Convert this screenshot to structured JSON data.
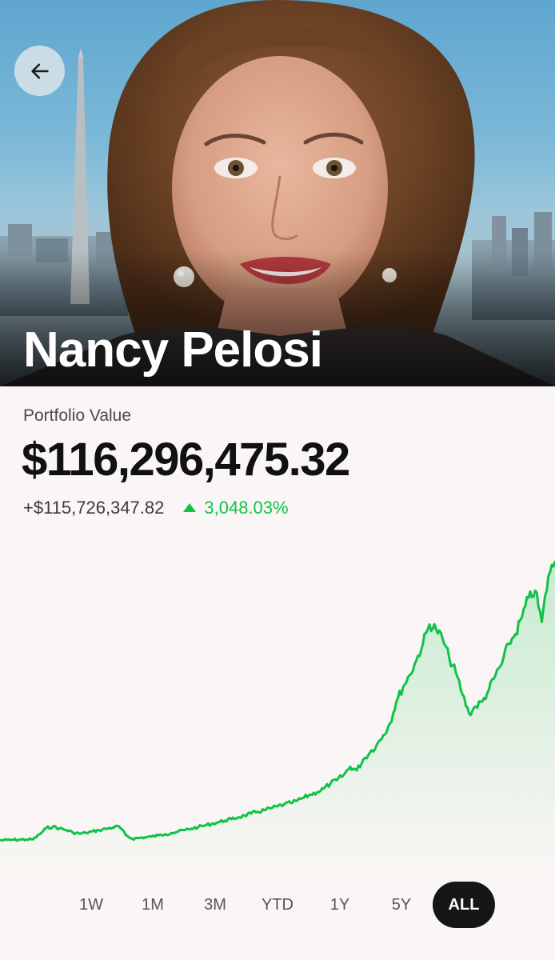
{
  "header": {
    "back_icon": "arrow-left-icon",
    "name": "Nancy Pelosi"
  },
  "portfolio": {
    "label": "Portfolio Value",
    "value": "$116,296,475.32",
    "change_amount": "+$115,726,347.82",
    "change_percent": "3,048.03%",
    "trend_icon": "triangle-up-icon"
  },
  "colors": {
    "positive": "#10c24a",
    "active_tab_bg": "#161616",
    "background": "#faf6f5"
  },
  "range_tabs": [
    {
      "label": "1W",
      "active": false
    },
    {
      "label": "1M",
      "active": false
    },
    {
      "label": "3M",
      "active": false
    },
    {
      "label": "YTD",
      "active": false
    },
    {
      "label": "1Y",
      "active": false
    },
    {
      "label": "5Y",
      "active": false
    },
    {
      "label": "ALL",
      "active": true
    }
  ],
  "chart_data": {
    "type": "area",
    "title": "",
    "xlabel": "",
    "ylabel": "",
    "ylim": [
      0,
      120000000
    ],
    "grid": false,
    "color": "#10c24a",
    "series": [
      {
        "values": [
          570127,
          650000,
          720000,
          800000,
          860000,
          900000,
          3000000,
          5600000,
          6200000,
          5500000,
          4800000,
          3800000,
          3300000,
          3600000,
          4200000,
          4700000,
          5300000,
          5800000,
          6300000,
          2800000,
          1200000,
          1500000,
          1800000,
          2100000,
          2600000,
          3100000,
          3600000,
          4200000,
          4800000,
          5400000,
          6000000,
          6700000,
          7300000,
          8000000,
          8700000,
          9300000,
          10000000,
          10800000,
          11600000,
          12400000,
          13000000,
          13800000,
          14600000,
          15400000,
          16000000,
          17000000,
          18200000,
          19500000,
          20500000,
          22000000,
          24000000,
          25500000,
          27500000,
          31000000,
          29500000,
          34000000,
          37000000,
          40000000,
          44000000,
          49000000,
          58000000,
          64000000,
          69000000,
          75000000,
          82000000,
          90000000,
          88000000,
          84000000,
          76000000,
          70000000,
          61000000,
          53000000,
          56000000,
          58000000,
          63000000,
          69000000,
          74000000,
          82000000,
          86000000,
          93000000,
          101000000,
          104000000,
          91000000,
          110000000,
          116296475
        ]
      }
    ]
  }
}
